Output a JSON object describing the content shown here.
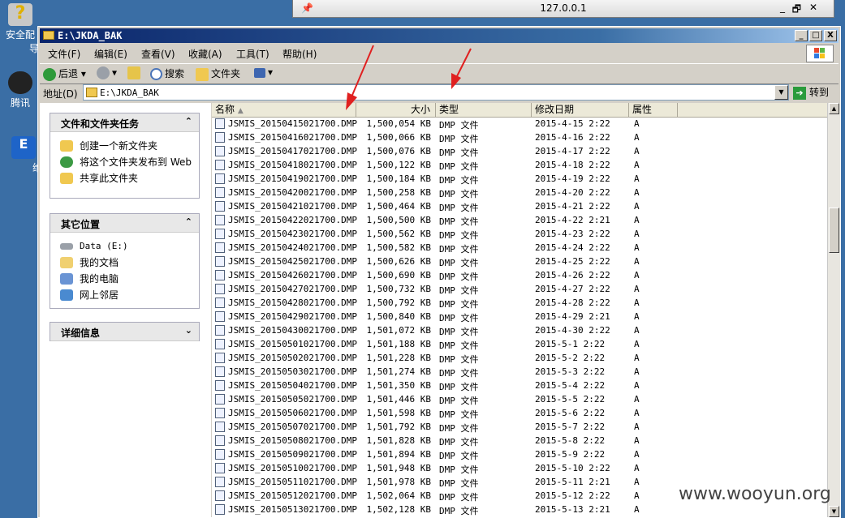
{
  "desktop": {
    "icons": [
      {
        "label": "安全配"
      },
      {
        "label": "导"
      },
      {
        "label": "腾讯"
      },
      {
        "label": "维"
      }
    ]
  },
  "rdp": {
    "title": "127.0.0.1",
    "min": "_",
    "restore": "🗗",
    "close": "✕"
  },
  "window": {
    "title": "E:\\JKDA_BAK",
    "controls": {
      "min": "_",
      "max": "□",
      "close": "X"
    }
  },
  "menu": [
    "文件(F)",
    "编辑(E)",
    "查看(V)",
    "收藏(A)",
    "工具(T)",
    "帮助(H)"
  ],
  "toolbar": {
    "back": "后退",
    "search": "搜索",
    "folders": "文件夹"
  },
  "address": {
    "label": "地址(D)",
    "value": "E:\\JKDA_BAK",
    "go": "转到"
  },
  "left": {
    "tasks": {
      "title": "文件和文件夹任务",
      "items": [
        "创建一个新文件夹",
        "将这个文件夹发布到 Web",
        "共享此文件夹"
      ]
    },
    "places": {
      "title": "其它位置",
      "items": [
        "Data (E:)",
        "我的文档",
        "我的电脑",
        "网上邻居"
      ]
    },
    "details": {
      "title": "详细信息"
    }
  },
  "columns": {
    "name": "名称",
    "size": "大小",
    "type": "类型",
    "modified": "修改日期",
    "attr": "属性"
  },
  "files": [
    {
      "name": "JSMIS_20150415021700.DMP",
      "size": "1,500,054 KB",
      "type": "DMP 文件",
      "date": "2015-4-15 2:22",
      "attr": "A"
    },
    {
      "name": "JSMIS_20150416021700.DMP",
      "size": "1,500,066 KB",
      "type": "DMP 文件",
      "date": "2015-4-16 2:22",
      "attr": "A"
    },
    {
      "name": "JSMIS_20150417021700.DMP",
      "size": "1,500,076 KB",
      "type": "DMP 文件",
      "date": "2015-4-17 2:22",
      "attr": "A"
    },
    {
      "name": "JSMIS_20150418021700.DMP",
      "size": "1,500,122 KB",
      "type": "DMP 文件",
      "date": "2015-4-18 2:22",
      "attr": "A"
    },
    {
      "name": "JSMIS_20150419021700.DMP",
      "size": "1,500,184 KB",
      "type": "DMP 文件",
      "date": "2015-4-19 2:22",
      "attr": "A"
    },
    {
      "name": "JSMIS_20150420021700.DMP",
      "size": "1,500,258 KB",
      "type": "DMP 文件",
      "date": "2015-4-20 2:22",
      "attr": "A"
    },
    {
      "name": "JSMIS_20150421021700.DMP",
      "size": "1,500,464 KB",
      "type": "DMP 文件",
      "date": "2015-4-21 2:22",
      "attr": "A"
    },
    {
      "name": "JSMIS_20150422021700.DMP",
      "size": "1,500,500 KB",
      "type": "DMP 文件",
      "date": "2015-4-22 2:21",
      "attr": "A"
    },
    {
      "name": "JSMIS_20150423021700.DMP",
      "size": "1,500,562 KB",
      "type": "DMP 文件",
      "date": "2015-4-23 2:22",
      "attr": "A"
    },
    {
      "name": "JSMIS_20150424021700.DMP",
      "size": "1,500,582 KB",
      "type": "DMP 文件",
      "date": "2015-4-24 2:22",
      "attr": "A"
    },
    {
      "name": "JSMIS_20150425021700.DMP",
      "size": "1,500,626 KB",
      "type": "DMP 文件",
      "date": "2015-4-25 2:22",
      "attr": "A"
    },
    {
      "name": "JSMIS_20150426021700.DMP",
      "size": "1,500,690 KB",
      "type": "DMP 文件",
      "date": "2015-4-26 2:22",
      "attr": "A"
    },
    {
      "name": "JSMIS_20150427021700.DMP",
      "size": "1,500,732 KB",
      "type": "DMP 文件",
      "date": "2015-4-27 2:22",
      "attr": "A"
    },
    {
      "name": "JSMIS_20150428021700.DMP",
      "size": "1,500,792 KB",
      "type": "DMP 文件",
      "date": "2015-4-28 2:22",
      "attr": "A"
    },
    {
      "name": "JSMIS_20150429021700.DMP",
      "size": "1,500,840 KB",
      "type": "DMP 文件",
      "date": "2015-4-29 2:21",
      "attr": "A"
    },
    {
      "name": "JSMIS_20150430021700.DMP",
      "size": "1,501,072 KB",
      "type": "DMP 文件",
      "date": "2015-4-30 2:22",
      "attr": "A"
    },
    {
      "name": "JSMIS_20150501021700.DMP",
      "size": "1,501,188 KB",
      "type": "DMP 文件",
      "date": "2015-5-1 2:22",
      "attr": "A"
    },
    {
      "name": "JSMIS_20150502021700.DMP",
      "size": "1,501,228 KB",
      "type": "DMP 文件",
      "date": "2015-5-2 2:22",
      "attr": "A"
    },
    {
      "name": "JSMIS_20150503021700.DMP",
      "size": "1,501,274 KB",
      "type": "DMP 文件",
      "date": "2015-5-3 2:22",
      "attr": "A"
    },
    {
      "name": "JSMIS_20150504021700.DMP",
      "size": "1,501,350 KB",
      "type": "DMP 文件",
      "date": "2015-5-4 2:22",
      "attr": "A"
    },
    {
      "name": "JSMIS_20150505021700.DMP",
      "size": "1,501,446 KB",
      "type": "DMP 文件",
      "date": "2015-5-5 2:22",
      "attr": "A"
    },
    {
      "name": "JSMIS_20150506021700.DMP",
      "size": "1,501,598 KB",
      "type": "DMP 文件",
      "date": "2015-5-6 2:22",
      "attr": "A"
    },
    {
      "name": "JSMIS_20150507021700.DMP",
      "size": "1,501,792 KB",
      "type": "DMP 文件",
      "date": "2015-5-7 2:22",
      "attr": "A"
    },
    {
      "name": "JSMIS_20150508021700.DMP",
      "size": "1,501,828 KB",
      "type": "DMP 文件",
      "date": "2015-5-8 2:22",
      "attr": "A"
    },
    {
      "name": "JSMIS_20150509021700.DMP",
      "size": "1,501,894 KB",
      "type": "DMP 文件",
      "date": "2015-5-9 2:22",
      "attr": "A"
    },
    {
      "name": "JSMIS_20150510021700.DMP",
      "size": "1,501,948 KB",
      "type": "DMP 文件",
      "date": "2015-5-10 2:22",
      "attr": "A"
    },
    {
      "name": "JSMIS_20150511021700.DMP",
      "size": "1,501,978 KB",
      "type": "DMP 文件",
      "date": "2015-5-11 2:21",
      "attr": "A"
    },
    {
      "name": "JSMIS_20150512021700.DMP",
      "size": "1,502,064 KB",
      "type": "DMP 文件",
      "date": "2015-5-12 2:22",
      "attr": "A"
    },
    {
      "name": "JSMIS_20150513021700.DMP",
      "size": "1,502,128 KB",
      "type": "DMP 文件",
      "date": "2015-5-13 2:21",
      "attr": "A"
    }
  ],
  "watermark": "www.wooyun.org",
  "colors": {
    "titlebar": "#0a246a",
    "arrow": "#e02020",
    "desktop": "#3a6ea5"
  }
}
